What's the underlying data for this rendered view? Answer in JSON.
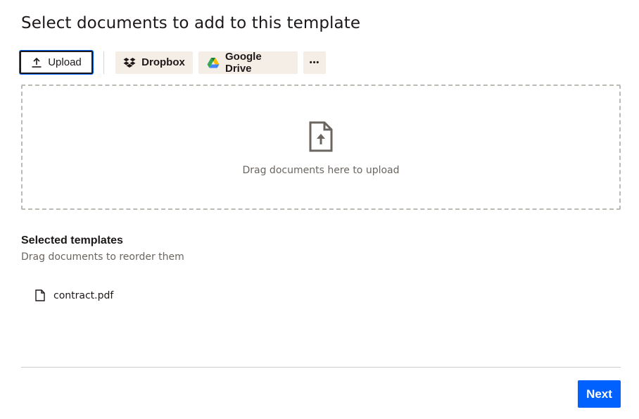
{
  "header": {
    "title": "Select documents to add to this template"
  },
  "toolbar": {
    "upload_label": "Upload",
    "dropbox_label": "Dropbox",
    "gdrive_label": "Google Drive",
    "more_label": "•••",
    "icons": {
      "upload": "upload-icon",
      "dropbox": "dropbox-icon",
      "gdrive": "google-drive-icon",
      "more": "more-options-icon"
    }
  },
  "dropzone": {
    "hint": "Drag documents here to upload",
    "icon": "document-upload-icon"
  },
  "selected": {
    "title": "Selected templates",
    "subtitle": "Drag documents to reorder them",
    "files": [
      {
        "name": "contract.pdf",
        "icon": "file-icon"
      }
    ]
  },
  "footer": {
    "next_label": "Next"
  },
  "colors": {
    "accent": "#0061fe",
    "soft_button": "#f4eee6",
    "text": "#1e1919",
    "muted": "#6b6560"
  }
}
